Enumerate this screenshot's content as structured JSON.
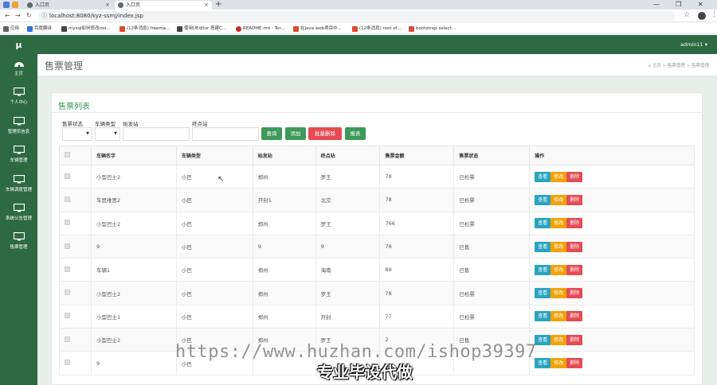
{
  "browser": {
    "tabs": [
      {
        "label": "入口页"
      },
      {
        "label": "入口页"
      }
    ],
    "url": "localhost:8080/kyz-ssmj/index.jsp",
    "bookmarks": [
      "应用",
      "百度翻译",
      "mysql如何修改roo...",
      "(12条消息) freema...",
      "使用UEditor 搭建C...",
      "README.md - Ter...",
      "在java web项目中...",
      "(12条消息) root of...",
      "bootstrap-select..."
    ]
  },
  "app": {
    "logo": "μ",
    "user": "admin11 ▾",
    "nav": [
      {
        "label": "主页",
        "icon": "dashboard-icon"
      },
      {
        "label": "个人中心",
        "icon": "monitor-icon"
      },
      {
        "label": "管理员信息",
        "icon": "monitor-icon"
      },
      {
        "label": "车辆管理",
        "icon": "monitor-icon"
      },
      {
        "label": "车辆调度管理",
        "icon": "monitor-icon"
      },
      {
        "label": "系统公告管理",
        "icon": "monitor-icon"
      },
      {
        "label": "售票管理",
        "icon": "monitor-icon"
      }
    ],
    "page_title": "售票管理",
    "breadcrumb": {
      "home": "主页",
      "level1": "售票管理",
      "level2": "售票管理",
      "sep": ">"
    }
  },
  "panel": {
    "title": "售票列表",
    "filters": {
      "status_label": "售票状态",
      "type_label": "车辆类型",
      "start_label": "始发站",
      "end_label": "终点站"
    },
    "buttons": {
      "search": "查询",
      "add": "添加",
      "batch_delete": "批量删除",
      "report": "报表"
    },
    "colors": {
      "search": "#3c9a5a",
      "add": "#3c9a5a",
      "batch_delete": "#e64a52",
      "report": "#3c9a5a",
      "view": "#2aa3c0",
      "edit": "#f0a30a",
      "delete": "#e64a52",
      "sidebar": "#2d6a42"
    }
  },
  "table": {
    "columns": [
      "车辆名字",
      "车辆类型",
      "始发站",
      "终点站",
      "售票金额",
      "售票状态",
      "操作"
    ],
    "actions": {
      "view": "查看",
      "edit": "修改",
      "delete": "删除"
    },
    "rows": [
      [
        "小型巴士2",
        "小巴",
        "郑州",
        "罗王",
        "78",
        "已检票"
      ],
      [
        "车思维思2",
        "小巴",
        "开封1",
        "北京",
        "78",
        "已检票"
      ],
      [
        "小型巴士2",
        "小巴",
        "郑州",
        "罗王",
        "766",
        "已检票"
      ],
      [
        "9",
        "小巴",
        "9",
        "9",
        "78",
        "已售"
      ],
      [
        "车辆1",
        "小巴",
        "郑州",
        "海南",
        "89",
        "已售"
      ],
      [
        "小型巴士2",
        "小巴",
        "郑州",
        "罗王",
        "78",
        "已检票"
      ],
      [
        "小型巴士1",
        "小巴",
        "郑州",
        "开封",
        "77",
        "已检票"
      ],
      [
        "小型巴士2",
        "小巴",
        "郑州",
        "罗王",
        "2",
        "已售"
      ],
      [
        "9",
        "小巴",
        "",
        "",
        "",
        ""
      ]
    ]
  },
  "overlay": {
    "watermark": "https://www.huzhan.com/ishop39397",
    "caption": "专业毕设代做"
  }
}
